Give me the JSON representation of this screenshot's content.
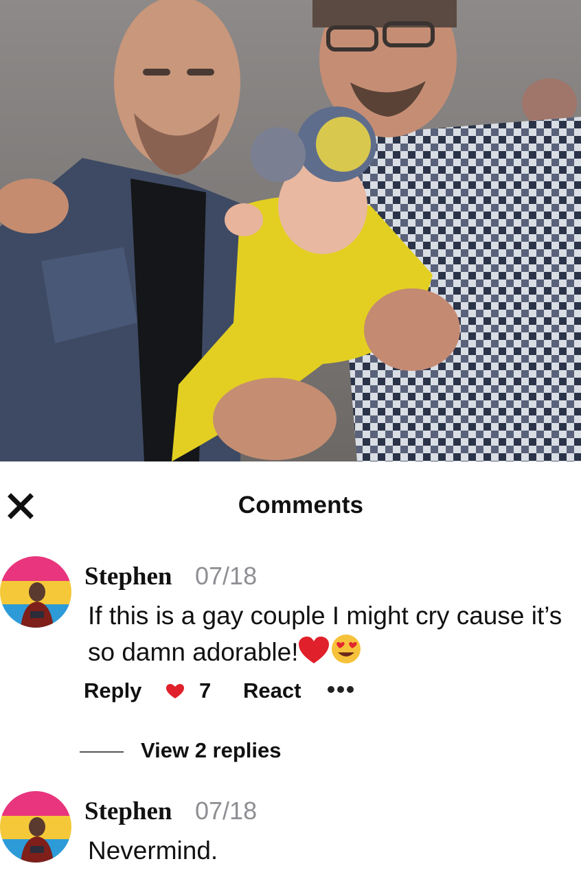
{
  "header": {
    "title": "Comments",
    "close_icon": "close-icon"
  },
  "comments": [
    {
      "author": "Stephen",
      "date": "07/18",
      "text": "If this is a gay couple I might cry cause it’s so damn adorable!",
      "emojis": [
        "red-heart-icon",
        "heart-eyes-icon"
      ],
      "actions": {
        "reply_label": "Reply",
        "reaction_icon": "heart-icon",
        "reaction_count": "7",
        "react_label": "React",
        "more_icon": "more-dots-icon"
      },
      "view_replies_label": "View 2 replies"
    },
    {
      "author": "Stephen",
      "date": "07/18",
      "text": "Nevermind."
    }
  ],
  "colors": {
    "heart_red": "#e0202a",
    "date_gray": "#8e8e93",
    "avatar_stripes": [
      "#e8357d",
      "#f5c83a",
      "#2d9bd8"
    ]
  }
}
